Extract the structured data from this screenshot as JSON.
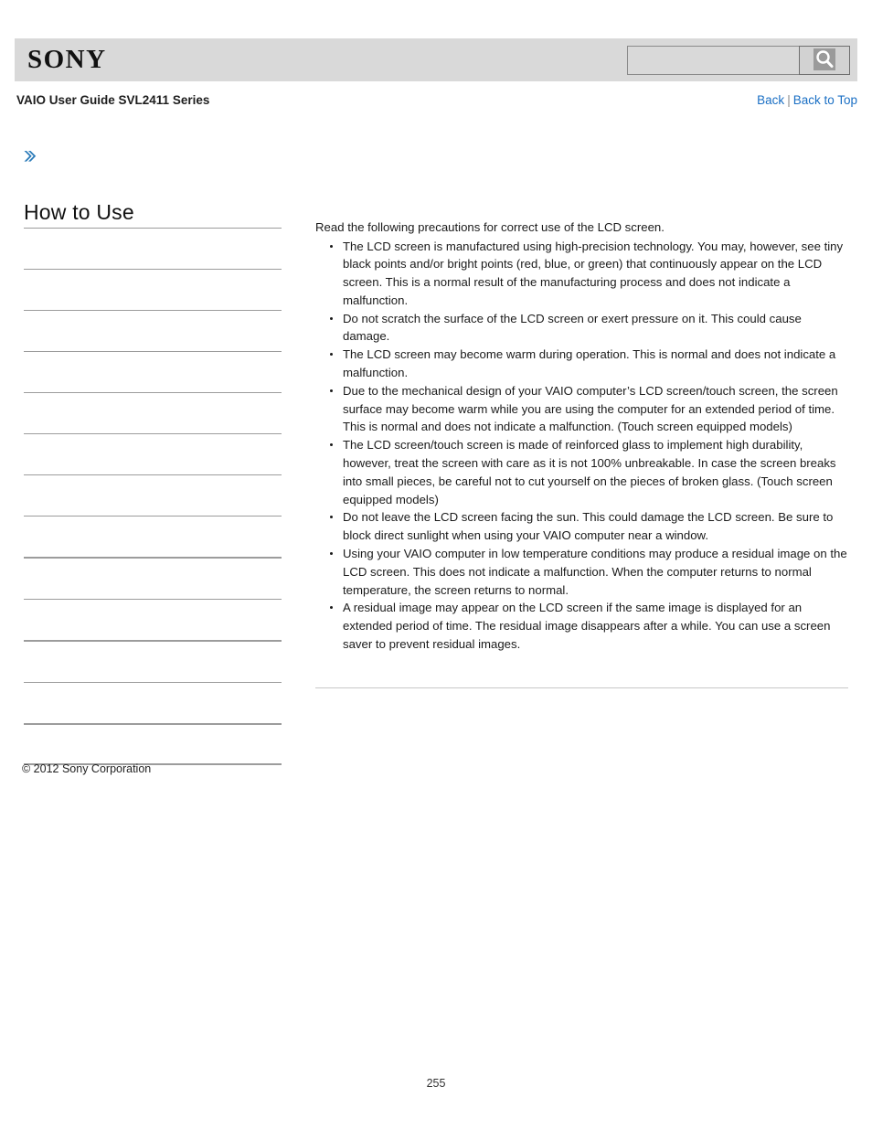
{
  "header": {
    "logo_text": "SONY",
    "search": {
      "value": "",
      "placeholder": "",
      "icon": "search-icon",
      "button_label": ""
    }
  },
  "title_bar": {
    "guide_title": "VAIO User Guide SVL2411 Series",
    "back_label": "Back",
    "separator": "|",
    "back_to_top_label": "Back to Top"
  },
  "breadcrumb": {
    "icon": "double-chevron-right-icon"
  },
  "sidebar": {
    "heading": "How to Use",
    "items": [
      {
        "label": ""
      },
      {
        "label": ""
      },
      {
        "label": ""
      },
      {
        "label": ""
      },
      {
        "label": ""
      },
      {
        "label": ""
      },
      {
        "label": ""
      },
      {
        "label": ""
      },
      {
        "label": ""
      },
      {
        "label": ""
      },
      {
        "label": ""
      },
      {
        "label": ""
      },
      {
        "label": ""
      }
    ],
    "copyright": "© 2012 Sony Corporation"
  },
  "main": {
    "lead": "Read the following precautions for correct use of the LCD screen.",
    "bullets": [
      "The LCD screen is manufactured using high-precision technology. You may, however, see tiny black points and/or bright points (red, blue, or green) that continuously appear on the LCD screen. This is a normal result of the manufacturing process and does not indicate a malfunction.",
      "Do not scratch the surface of the LCD screen or exert pressure on it. This could cause damage.",
      "The LCD screen may become warm during operation. This is normal and does not indicate a malfunction.",
      "Due to the mechanical design of your VAIO computer’s LCD screen/touch screen, the screen surface may become warm while you are using the computer for an extended period of time. This is normal and does not indicate a malfunction. (Touch screen equipped models)",
      "The LCD screen/touch screen is made of reinforced glass to implement high durability, however, treat the screen with care as it is not 100% unbreakable. In case the screen breaks into small pieces, be careful not to cut yourself on the pieces of broken glass. (Touch screen equipped models)",
      "Do not leave the LCD screen facing the sun. This could damage the LCD screen. Be sure to block direct sunlight when using your VAIO computer near a window.",
      "Using your VAIO computer in low temperature conditions may produce a residual image on the LCD screen. This does not indicate a malfunction. When the computer returns to normal temperature, the screen returns to normal.",
      "A residual image may appear on the LCD screen if the same image is displayed for an extended period of time. The residual image disappears after a while. You can use a screen saver to prevent residual images."
    ]
  },
  "footer": {
    "page_number": "255"
  },
  "colors": {
    "header_band": "#d9d9d9",
    "link": "#1a6fc4",
    "accent_arrow": "#2b7bb9",
    "rule": "#9c9c9c"
  }
}
